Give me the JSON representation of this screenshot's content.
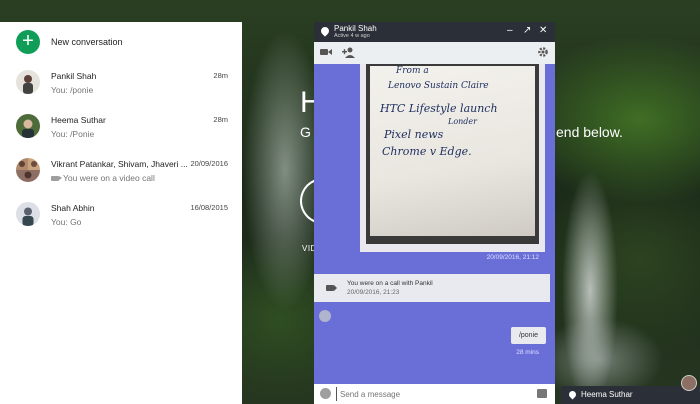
{
  "background": {
    "heading": "H",
    "subtitle_left": "G",
    "subtitle_right": "end below.",
    "button_label": "VID"
  },
  "sidebar": {
    "new_conversation_label": "New conversation",
    "conversations": [
      {
        "name": "Pankil Shah",
        "time": "28m",
        "preview": "You: /ponie"
      },
      {
        "name": "Heema Suthar",
        "time": "28m",
        "preview": "You: /Ponie"
      },
      {
        "name": "Vikrant Patankar, Shivam, Jhaveri ...",
        "time": "20/09/2016",
        "preview": "You were on a video call"
      },
      {
        "name": "Shah Abhin",
        "time": "16/08/2015",
        "preview": "You: Go"
      }
    ]
  },
  "chat": {
    "name": "Pankil Shah",
    "status": "Active 4 w ago",
    "photo_handwriting": [
      "From a",
      "Lenovo Sustain Claire",
      "HTC  Lifestyle launch",
      "Londer",
      "Pixel news",
      "Chrome v Edge."
    ],
    "photo_timestamp": "20/09/2016, 21:12",
    "call_text": "You were on a call with Pankil",
    "call_timestamp": "20/09/2016, 21:23",
    "message": "/ponie",
    "message_time": "28 mins",
    "composer_placeholder": "Send a message"
  },
  "mini_chat": {
    "name": "Heema Suthar"
  },
  "colors": {
    "accent_green": "#0f9d58",
    "chat_background": "#6a6fd8",
    "title_bar": "#2b2f38"
  }
}
